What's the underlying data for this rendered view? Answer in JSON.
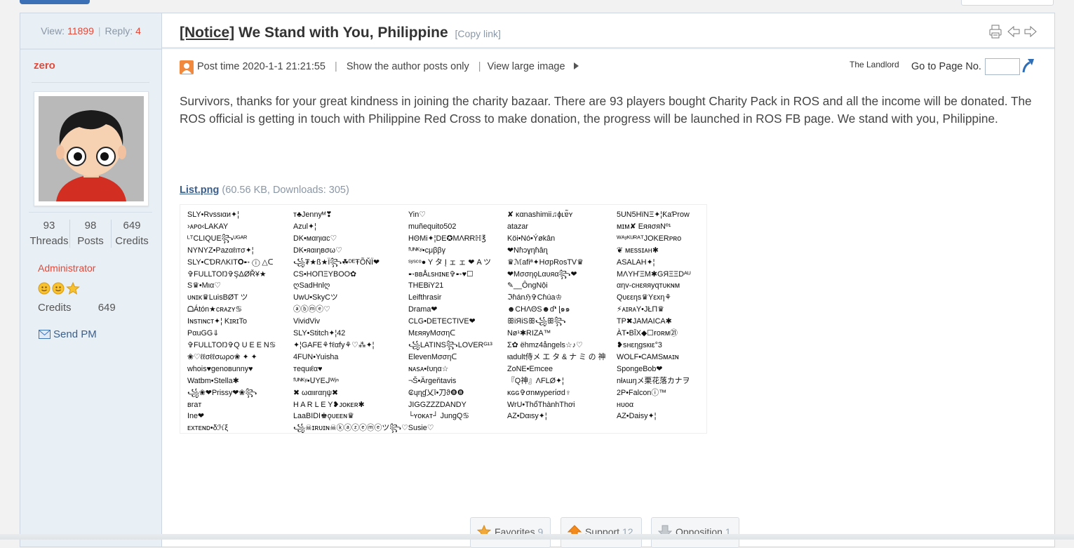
{
  "thread": {
    "view_label": "View:",
    "views": "11899",
    "reply_label": "Reply:",
    "replies": "4",
    "notice_tag": "[Notice]",
    "title": "We Stand with You, Philippine",
    "copy_link": "[Copy link]"
  },
  "author": {
    "name": "zero",
    "threads": "93",
    "threads_label": "Threads",
    "posts": "98",
    "posts_label": "Posts",
    "credits": "649",
    "credits_label": "Credits",
    "group": "Administrator",
    "credits_row_label": "Credits",
    "credits_row_value": "649",
    "send_pm": "Send PM"
  },
  "post_meta": {
    "post_time": "Post time 2020-1-1 21:21:55",
    "sep": "|",
    "author_only": "Show the author posts only",
    "view_large": "View large image",
    "landlord": "The Landlord",
    "go_to_page": "Go to Page No.",
    "page_value": ""
  },
  "content": {
    "text": "Survivors, thanks for your great kindness in joining the charity bazaar. There are 93 players bought Charity Pack in ROS and all the income will be donated. The ROS official is getting in touch with Philippine Red Cross to make donation, the progress will be launched in ROS FB page. We stand with you, Philippine."
  },
  "attachment": {
    "filename": "List.png",
    "info": "(60.56 KB, Downloads: 305)"
  },
  "list_image": {
    "col1": [
      "SLY•Rvssιαи✦¦",
      "›ᴀᴘᴏ‹LAKAY",
      "ᴸᵀCLIQUE꧂ᵁᴳᴬᴿ",
      "NYNYZ•Pazαℓιтσ✦¦",
      "SLY•ᑕƊRΛKIT𝐎➸ ⓘ △ᑕ",
      "✞FULLTOŊ✞ŞΔØŘ¥★",
      "S♛•Mια♡",
      "ᴜɴɪᴋ♛LuisBØT ツ",
      "ᗝÁtón★ᴄʀᴀᴢʏ♋",
      "Iɴsтιɴcт✦¦  KɪʀɪTo",
      "PαuGG⇓",
      "✞FULLTOŊ✞Q U E E N♋",
      "❀♡ℓℓσℓℓσωρᴏ❀ ✦ ✦",
      "whois♥genoвunny♥",
      "Watbm•Stella✱",
      "꧁❀❤Prissy❤❀꧂",
      "вraт",
      "Ine❤",
      "ᴇxᴛᴇɴᴅ•δℋξ"
    ],
    "col2": [
      "ᴛ♣Jennyᴹ❣",
      "Azul✦¦",
      "DK•мαηιαc♡",
      "DK•яαιηвσω♡",
      "꧁₮★ß★Ї꧂☘ᴰᴱŦÕŇÏ❤",
      "CS•HOΠΞYBOO✿",
      "ღSadHnlღ",
      "UwU•SkyCツ",
      "ⓐⓑⓜⓔ♡",
      "VividViv",
      "SLY•Stitch✦¦42",
      "✦¦GAFE⚘ϯℓαfy⚘♡⁂✦¦",
      "4FUN•Yuisha",
      "тequιℓα♥",
      "ᶠᵁᴺᴷʸ•ᑌYEᒍᵂʲⁿ",
      "✖ ωαιιrαηψ✖",
      "H A R L E Y❥ᴊᴏᴋᴇʀ✱",
      "LaaBIDI♚ǫᴜᴇᴇɴ♛",
      "꧁☠ɪʀᴜɪɴ☠ⓚⓐⓩⓔⓜⓔツ꧂♡Susie♡"
    ],
    "col3": [
      "Yin♡",
      "muñequito502",
      "HΘMi✦¦DE✪MΛɌɌℍ℥",
      "ᶠᵁᴺᴷʸ•cμββγ",
      "ˢʸˢᶜᵒ● Y タ Į ェ ェ ❤ A ツ",
      "➸ʙʙÅʟsʜɪɴᴇ✞➸♥☐",
      "THEBᎥY21",
      "Leifthrasir",
      "Drama❤",
      "CLG•DETECTIVE❤",
      "ΜεяяуΜσσηᑕ",
      "꧁LATINS꧂LOVERᴳ¹³",
      "ElevenMσσηᑕ",
      "ɴᴀꜱᴀ•ℓυηα☆",
      "¬Š•Ärgeňtavis",
      "₢ɥɳɠ乂ȉ•刀ϑ❽❽",
      "JIGGZZZDANDY",
      "└ʏᴏᴋᴀᴛ┘ JungQ♋"
    ],
    "col4": [
      "✘ ĸαnashimii♫ɸʟɐ̃ʏ",
      "atazar",
      "Köi•Nó•Ýøkân",
      "❤Nɦↄɣηɦâɳ",
      "♛ℳafiª✦HσpRosTV♛",
      "❤MσσηǫLαυяα꧂❤",
      "✎__ÔngNội",
      "ℑɦánℌ✞Cɦúa♔",
      "☻CHΛΘS☻ɗ❛ ɭ๑๑",
      "ꕥiЯiSꕥ꧁ꕥ꧂",
      "Nø¹✱RIZA™",
      "Σ✿ ëhmz4ångels☆♪♡",
      "ᵻadult侍メ エ タ & ナ ミ の 神",
      "ZoNE•Emcee",
      "『Q神』ΛFLØ✦¦",
      "ᴋɢɢ✞σnмуρerίσd♀",
      "WrU•ThổThànhThơi",
      "AZ•Dαιsу✦¦"
    ],
    "col5": [
      "5UN5HïNΞ✦¦ƘaƤrow",
      "ᴍɪᴍ✘ ΕяяσяΝº¹",
      "ᵂᴬʸᴷᵁᴿᴬᵀJOKERᴘʀᴏ",
      "❦ ᴍᴇssɪᴀʜ✱",
      "ASALAH✦¦",
      "ΜΛYҤΞΜ✱GЯΞΞDᴬᵁ",
      "αηv-cнεяяуqᴛᴜᴋɴᴍ",
      "Qυεεηs♛Yεxη⚘",
      "⚡ᴀɪʀᴀY•JŁП♛",
      "TP✖JAMAICA✱",
      "ÀT•BĪX◆☐ғᴏʀᴍ㉑",
      "❥sнεηgsкιε°3",
      "WOLF•CAMSᴍᴀɪɴ",
      "SpongeBob❤",
      "nłᴀɯŋメ栗花落カナヲ",
      "2P•Falconⓘ™",
      "ʜᴜᴏα",
      "AZ•Daisy✦¦"
    ]
  },
  "votes": {
    "favorites_label": "Favorites",
    "favorites_count": "9",
    "support_label": "Support",
    "support_count": "12",
    "opposition_label": "Opposition",
    "opposition_count": "1"
  },
  "colors": {
    "accent_red": "#e04a3a",
    "link_blue": "#3a5e8c",
    "sidebar_bg": "#e8eff5",
    "border": "#cdd6e0"
  }
}
